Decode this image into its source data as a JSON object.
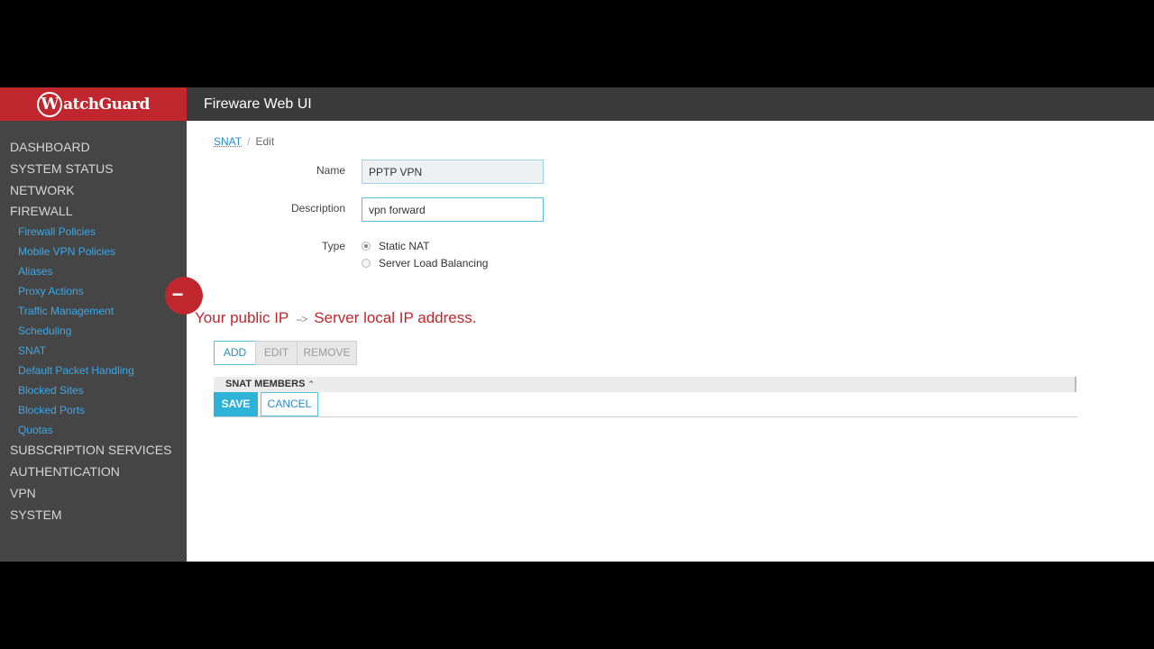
{
  "brand": {
    "logo_initial": "W",
    "logo_rest": "atchGuard"
  },
  "app": {
    "title": "Fireware Web UI"
  },
  "sidebar": {
    "main_items": [
      {
        "label": "DASHBOARD"
      },
      {
        "label": "SYSTEM STATUS"
      },
      {
        "label": "NETWORK"
      },
      {
        "label": "FIREWALL"
      }
    ],
    "firewall_items": [
      {
        "label": "Firewall Policies"
      },
      {
        "label": "Mobile VPN Policies"
      },
      {
        "label": "Aliases"
      },
      {
        "label": "Proxy Actions"
      },
      {
        "label": "Traffic Management"
      },
      {
        "label": "Scheduling"
      },
      {
        "label": "SNAT"
      },
      {
        "label": "Default Packet Handling"
      },
      {
        "label": "Blocked Sites"
      },
      {
        "label": "Blocked Ports"
      },
      {
        "label": "Quotas"
      }
    ],
    "bottom_items": [
      {
        "label": "SUBSCRIPTION SERVICES"
      },
      {
        "label": "AUTHENTICATION"
      },
      {
        "label": "VPN"
      },
      {
        "label": "SYSTEM"
      }
    ],
    "collapse_symbol": "−"
  },
  "breadcrumb": {
    "parent": "SNAT",
    "separator": "/",
    "current": "Edit"
  },
  "form": {
    "name_label": "Name",
    "name_value": "PPTP VPN",
    "description_label": "Description",
    "description_value": "vpn forward",
    "type_label": "Type",
    "type_options": [
      {
        "label": "Static NAT",
        "selected": true
      },
      {
        "label": "Server Load Balancing",
        "selected": false
      }
    ]
  },
  "members": {
    "header": "SNAT MEMBERS",
    "sort_indicator": "⌃",
    "buttons": {
      "add": "ADD",
      "edit": "EDIT",
      "remove": "REMOVE"
    }
  },
  "annotation": {
    "left": "Your public IP",
    "arrow": "-->",
    "right": "Server local IP address."
  },
  "actions": {
    "save": "SAVE",
    "cancel": "CANCEL"
  },
  "colors": {
    "brand_red": "#c0262d",
    "topbar": "#3a3a3a",
    "sidebar": "#454545",
    "link_blue": "#3aa8e8",
    "save_blue": "#2eb3d8"
  }
}
